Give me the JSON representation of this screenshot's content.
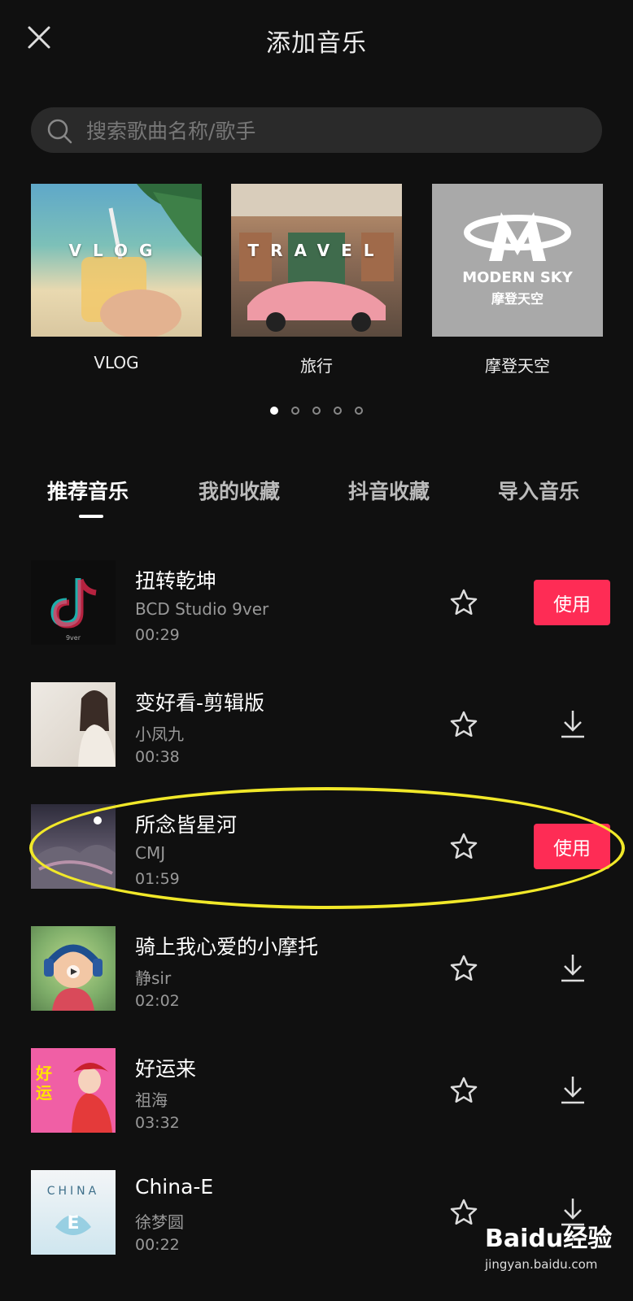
{
  "header": {
    "title": "添加音乐"
  },
  "search": {
    "placeholder": "搜索歌曲名称/歌手"
  },
  "categories": [
    {
      "label": "VLOG",
      "overlay": "VLOG"
    },
    {
      "label": "旅行",
      "overlay": "TRAVEL"
    },
    {
      "label": "摩登天空",
      "overlay_en": "MODERN SKY",
      "overlay_cn": "摩登天空"
    }
  ],
  "carousel": {
    "pages": 5,
    "active_page": 1
  },
  "tabs": [
    {
      "label": "推荐音乐",
      "active": true
    },
    {
      "label": "我的收藏",
      "active": false
    },
    {
      "label": "抖音收藏",
      "active": false
    },
    {
      "label": "导入音乐",
      "active": false
    }
  ],
  "songs": [
    {
      "title": "扭转乾坤",
      "artist": "BCD Studio 9ver",
      "duration": "00:29",
      "action": "use",
      "action_label": "使用"
    },
    {
      "title": "变好看-剪辑版",
      "artist": "小凤九",
      "duration": "00:38",
      "action": "download"
    },
    {
      "title": "所念皆星河",
      "artist": "CMJ",
      "duration": "01:59",
      "action": "use",
      "action_label": "使用"
    },
    {
      "title": "骑上我心爱的小摩托",
      "artist": "静sir",
      "duration": "02:02",
      "action": "download"
    },
    {
      "title": "好运来",
      "artist": "祖海",
      "duration": "03:32",
      "action": "download"
    },
    {
      "title": "China-E",
      "artist": "徐梦圆",
      "duration": "00:22",
      "action": "download"
    }
  ],
  "watermark": {
    "brand": "Baidu经验",
    "url": "jingyan.baidu.com"
  },
  "colors": {
    "background": "#101010",
    "accent": "#fe2c55",
    "highlight": "#f1e829"
  }
}
